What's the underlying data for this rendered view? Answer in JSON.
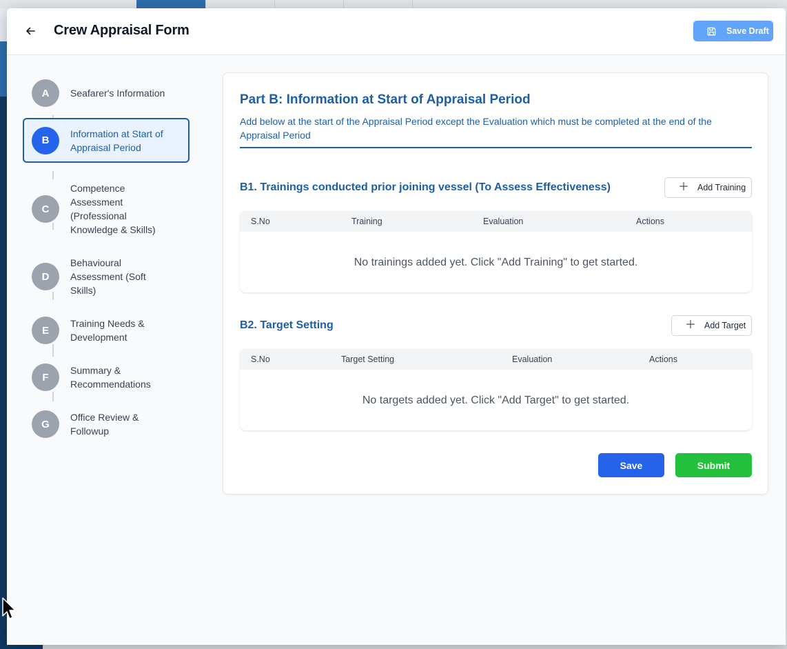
{
  "header": {
    "title": "Crew Appraisal Form",
    "save_draft_label": "Save Draft"
  },
  "steps": [
    {
      "letter": "A",
      "label": "Seafarer's Information",
      "active": false
    },
    {
      "letter": "B",
      "label": "Information at Start of Appraisal Period",
      "active": true
    },
    {
      "letter": "C",
      "label": "Competence Assessment (Professional Knowledge & Skills)",
      "active": false
    },
    {
      "letter": "D",
      "label": "Behavioural Assessment (Soft Skills)",
      "active": false
    },
    {
      "letter": "E",
      "label": "Training Needs & Development",
      "active": false
    },
    {
      "letter": "F",
      "label": "Summary & Recommendations",
      "active": false
    },
    {
      "letter": "G",
      "label": "Office Review & Followup",
      "active": false
    }
  ],
  "part": {
    "title": "Part B: Information at Start of Appraisal Period",
    "description": "Add below at the start of the Appraisal Period except the Evaluation which must be completed at the end of the Appraisal Period"
  },
  "trainings": {
    "title": "B1. Trainings conducted prior joining vessel (To Assess Effectiveness)",
    "add_label": "Add Training",
    "columns": [
      "S.No",
      "Training",
      "Evaluation",
      "Actions"
    ],
    "empty_text": "No trainings added yet. Click \"Add Training\" to get started."
  },
  "targets": {
    "title": "B2. Target Setting",
    "add_label": "Add Target",
    "columns": [
      "S.No",
      "Target Setting",
      "Evaluation",
      "Actions"
    ],
    "empty_text": "No targets added yet. Click \"Add Target\" to get started."
  },
  "actions": {
    "save_label": "Save",
    "submit_label": "Submit"
  },
  "colors": {
    "accent": "#1d5fa6",
    "primary_button": "#2563eb",
    "submit_button": "#22c03c",
    "save_draft_button": "#60a5fa",
    "inactive_step": "#9ca3af"
  }
}
